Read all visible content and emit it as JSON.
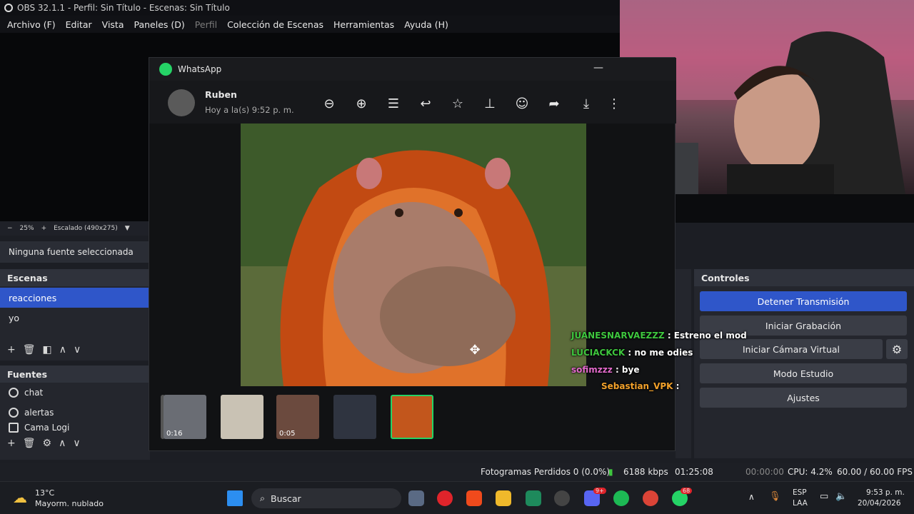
{
  "obs": {
    "window_title": "OBS 32.1.1 - Perfil: Sin Título - Escenas: Sin Título",
    "menu": [
      "Archivo (F)",
      "Editar",
      "Vista",
      "Paneles (D)",
      "Perfil",
      "Colección de Escenas",
      "Herramientas",
      "Ayuda (H)"
    ],
    "preview_bar": {
      "zoom": "25%",
      "scaling": "Escalado (490x275)"
    },
    "source_status": "Ninguna fuente seleccionada",
    "scenes": {
      "title": "Escenas",
      "items": [
        "reacciones",
        "yo"
      ]
    },
    "sources": {
      "title": "Fuentes",
      "items": [
        "chat",
        "alertas",
        "Cama Logi"
      ]
    },
    "controls": {
      "title": "Controles",
      "buttons": [
        "Detener Transmisión",
        "Iniciar Grabación",
        "Iniciar Cámara Virtual",
        "Modo Estudio",
        "Ajustes"
      ]
    },
    "status": {
      "dropped_frames": "Fotogramas Perdidos 0 (0.0%)",
      "bitrate": "6188 kbps",
      "stream_time": "01:25:08",
      "record_time": "00:00:00",
      "cpu": "CPU: 4.2%",
      "fps": "60.00 / 60.00 FPS"
    }
  },
  "whatsapp": {
    "title": "WhatsApp",
    "sender": "Ruben",
    "timestamp": "Hoy a la(s) 9:52 p. m.",
    "tools": [
      "zoom-out-icon",
      "zoom-in-icon",
      "caption-icon",
      "reply-icon",
      "star-icon",
      "pin-icon",
      "emoji-icon",
      "forward-icon",
      "download-icon",
      "more-icon"
    ],
    "thumbnails": [
      {
        "duration": "0:16"
      },
      {
        "duration": ""
      },
      {
        "duration": "0:05"
      },
      {
        "duration": ""
      },
      {
        "duration": ""
      }
    ]
  },
  "chat": [
    {
      "user": "JUANESNARVAEZZZ",
      "text": ": Estreno el mod",
      "color": "#3ec63e"
    },
    {
      "user": "LUCIACKCK",
      "text": ": no me odies",
      "color": "#3ec63e"
    },
    {
      "user": "sofimzzz",
      "text": ": bye",
      "color": "#e26acb"
    },
    {
      "user": "Sebastian_VPK",
      "text": ":",
      "color": "#f2a12b"
    }
  ],
  "taskbar": {
    "weather_temp": "13°C",
    "weather_desc": "Mayorm. nublado",
    "search": "Buscar",
    "badge_discord": "9+",
    "badge_whatsapp": "68",
    "lang": "ESP",
    "lang2": "LAA",
    "time": "9:53 p. m.",
    "date": "20/04/2026"
  }
}
